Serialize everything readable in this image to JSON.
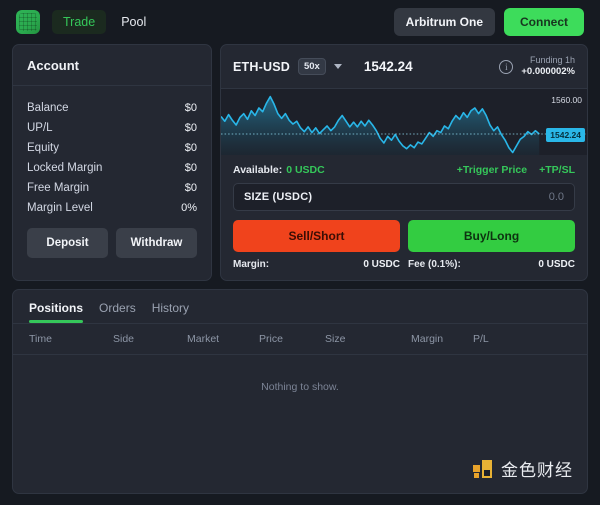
{
  "header": {
    "logo_name": "app-logo",
    "nav": [
      {
        "label": "Trade",
        "active": true
      },
      {
        "label": "Pool",
        "active": false
      }
    ],
    "network_button": "Arbitrum One",
    "connect_button": "Connect"
  },
  "account": {
    "title": "Account",
    "rows": [
      {
        "label": "Balance",
        "value": "$0"
      },
      {
        "label": "UP/L",
        "value": "$0"
      },
      {
        "label": "Equity",
        "value": "$0"
      },
      {
        "label": "Locked Margin",
        "value": "$0"
      },
      {
        "label": "Free Margin",
        "value": "$0"
      },
      {
        "label": "Margin Level",
        "value": "0%"
      }
    ],
    "deposit_button": "Deposit",
    "withdraw_button": "Withdraw"
  },
  "trade": {
    "symbol": "ETH-USD",
    "leverage": "50x",
    "price": "1542.24",
    "funding_label": "Funding 1h",
    "funding_value": "+0.000002%",
    "available_label": "Available:",
    "available_value": "0 USDC",
    "trigger_price_link": "+Trigger Price",
    "tpsl_link": "+TP/SL",
    "size_label": "SIZE (USDC)",
    "size_placeholder": "0.0",
    "sell_button": "Sell/Short",
    "buy_button": "Buy/Long",
    "margin_label": "Margin:",
    "margin_value": "0 USDC",
    "fee_label": "Fee (0.1%):",
    "fee_value": "0 USDC"
  },
  "chart_data": {
    "type": "line",
    "title": "ETH-USD price",
    "xlabel": "",
    "ylabel": "",
    "axis_tick_labels": [
      "1560.00"
    ],
    "current_price_label": "1542.24",
    "current_price": 1542.24,
    "ylim": [
      1528,
      1566
    ],
    "grid": false,
    "legend": "none",
    "line_color": "#29b6e8",
    "fill_color": "#1c4f63",
    "series": [
      {
        "name": "ETH-USD",
        "values": [
          1551.5,
          1549.0,
          1552.5,
          1549.5,
          1547.0,
          1551.0,
          1553.0,
          1550.0,
          1554.5,
          1552.0,
          1556.0,
          1554.0,
          1558.5,
          1562.0,
          1558.0,
          1553.0,
          1550.5,
          1553.0,
          1549.5,
          1547.5,
          1549.0,
          1545.5,
          1543.5,
          1546.0,
          1543.0,
          1545.5,
          1542.5,
          1544.5,
          1546.5,
          1544.0,
          1546.0,
          1549.5,
          1552.0,
          1549.0,
          1546.0,
          1548.5,
          1546.0,
          1549.0,
          1546.5,
          1549.5,
          1547.0,
          1544.0,
          1540.0,
          1537.5,
          1541.0,
          1539.0,
          1542.0,
          1538.5,
          1536.0,
          1534.5,
          1536.5,
          1535.0,
          1538.0,
          1537.0,
          1540.0,
          1543.0,
          1541.0,
          1544.0,
          1543.0,
          1546.5,
          1545.0,
          1549.0,
          1552.0,
          1550.0,
          1553.5,
          1551.0,
          1554.5,
          1556.0,
          1553.0,
          1555.5,
          1552.0,
          1547.0,
          1544.0,
          1546.0,
          1542.0,
          1539.0,
          1535.0,
          1532.5,
          1536.0,
          1539.5,
          1541.0,
          1543.5,
          1542.0,
          1544.0,
          1542.24
        ]
      }
    ]
  },
  "bottom": {
    "tabs": [
      {
        "label": "Positions",
        "active": true
      },
      {
        "label": "Orders",
        "active": false
      },
      {
        "label": "History",
        "active": false
      }
    ],
    "columns": [
      "Time",
      "Side",
      "Market",
      "Price",
      "Size",
      "Margin",
      "P/L"
    ],
    "empty_message": "Nothing to show.",
    "watermark_text": "金色财经"
  }
}
